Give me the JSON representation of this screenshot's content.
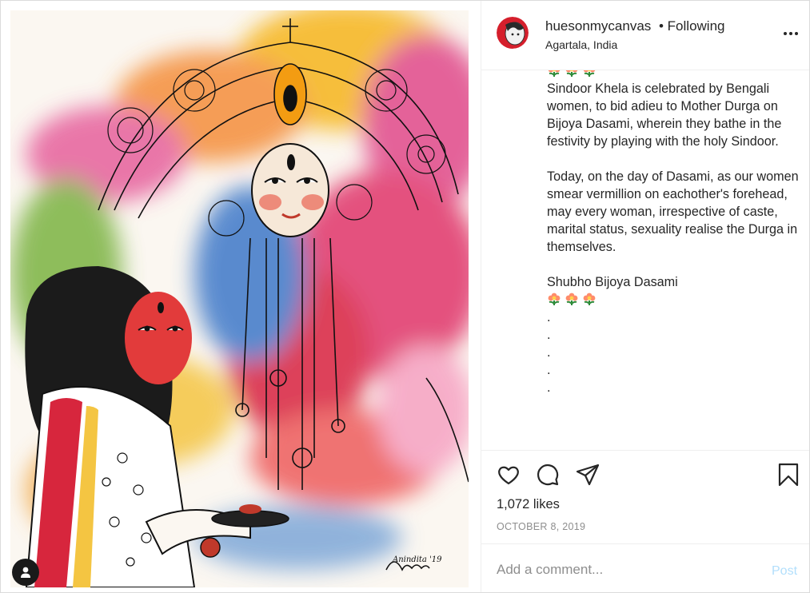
{
  "post": {
    "username": "huesonmycanvas",
    "follow_status": "• Following",
    "location": "Agartala, India",
    "more_icon": "more-horizontal-icon"
  },
  "caption": {
    "paragraphs": [
      "Sindoor Khela is celebrated by Bengali women, to bid adieu to Mother Durga on Bijoya Dasami, wherein they bathe in the festivity by playing with the holy Sindoor.",
      "Today, on the day of Dasami, as our women smear vermillion on eachother's forehead, may every woman, irrespective of caste, marital status, sexuality realise the Durga in themselves.",
      "Shubho Bijoya Dasami"
    ],
    "dots": [
      ".",
      ".",
      ".",
      ".",
      "."
    ],
    "emoji_name": "blossom-emoji"
  },
  "actions": {
    "like_icon": "heart-icon",
    "comment_icon": "comment-icon",
    "share_icon": "paper-plane-icon",
    "save_icon": "bookmark-icon"
  },
  "likes": "1,072 likes",
  "date": "OCTOBER 8, 2019",
  "comment": {
    "placeholder": "Add a comment...",
    "post_label": "Post"
  },
  "artwork": {
    "signature": "Anindita '19"
  },
  "colors": {
    "text": "#262626",
    "muted": "#8e8e8e",
    "post_button_disabled": "#b2dffc",
    "border": "#dbdbdb"
  }
}
